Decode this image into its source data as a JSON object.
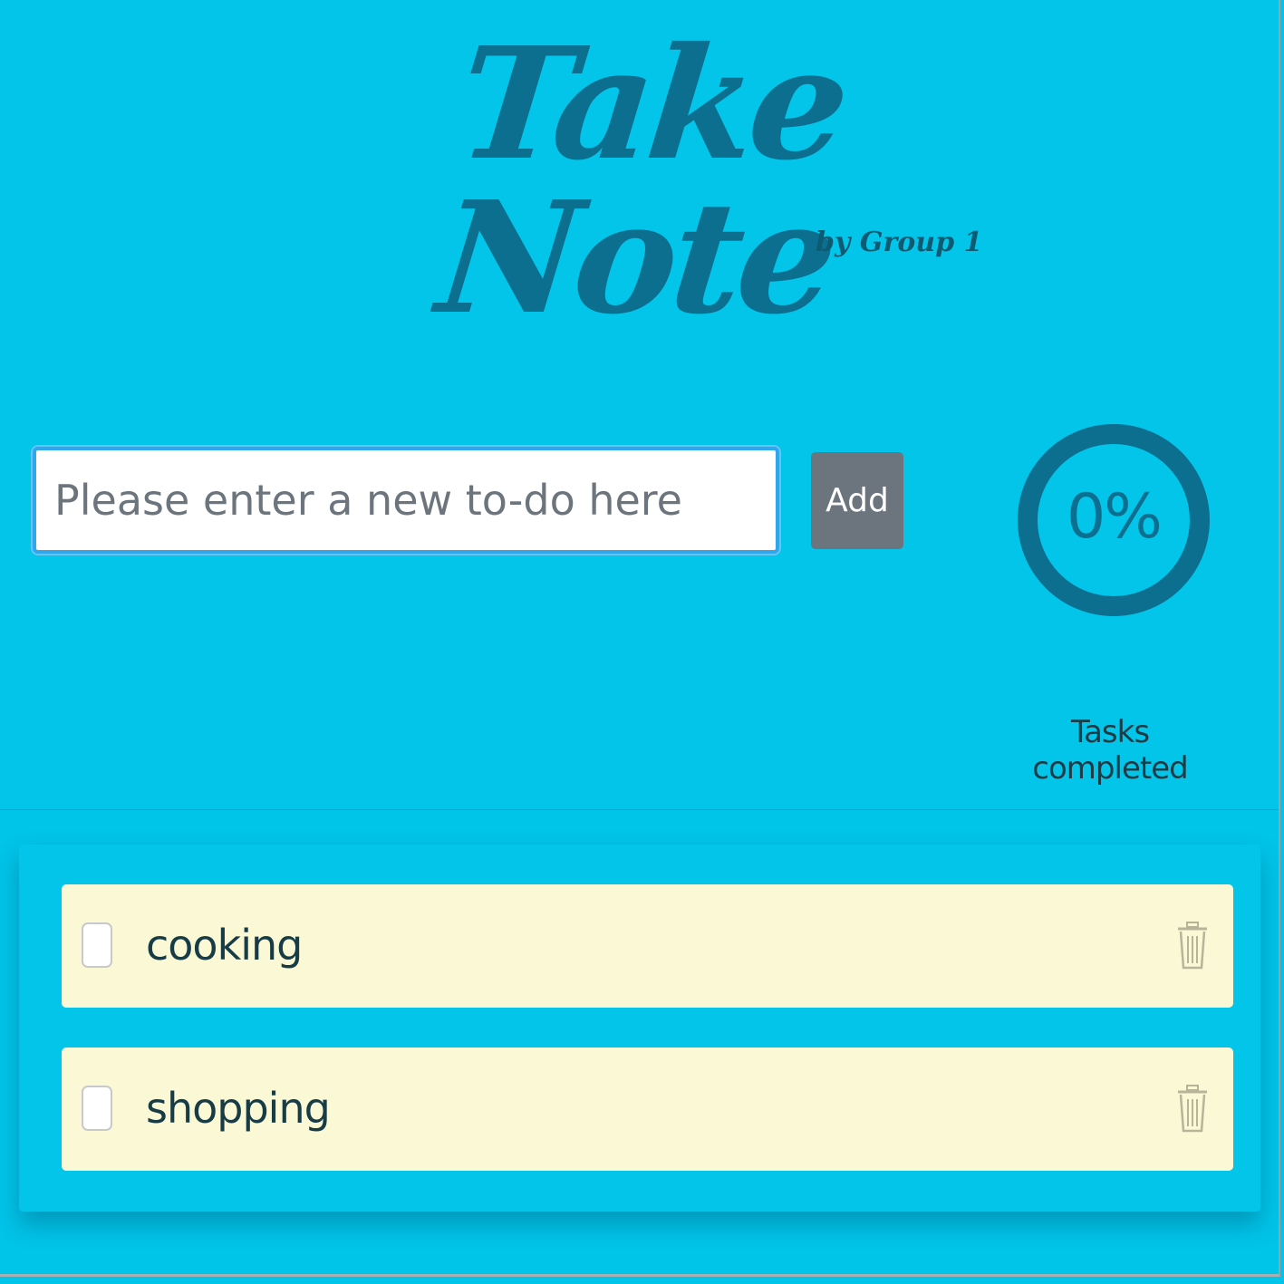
{
  "app": {
    "title": "Take Note",
    "subtitle": "by Group 1"
  },
  "input": {
    "placeholder": "Please enter a new to-do here",
    "value": ""
  },
  "add_button": {
    "label": "Add"
  },
  "progress": {
    "value": 0,
    "display": "0%",
    "label": "Tasks completed"
  },
  "todos": [
    {
      "label": "cooking",
      "completed": false
    },
    {
      "label": "shopping",
      "completed": false
    }
  ],
  "colors": {
    "background": "#00c4e8",
    "accent": "#0c6f8f",
    "item_background": "#faf8d5",
    "button": "#6c757d",
    "input_focus": "#2ea7ee"
  },
  "icons": {
    "trash": "trash-icon",
    "checkbox": "checkbox"
  }
}
